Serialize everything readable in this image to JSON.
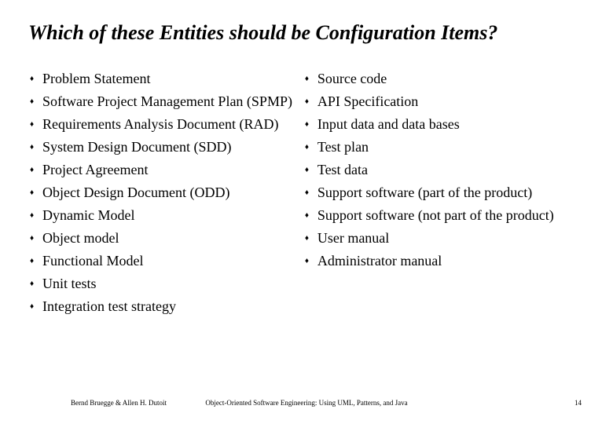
{
  "title": "Which of these Entities should be Configuration Items?",
  "left_items": [
    "Problem Statement",
    "Software Project Management Plan (SPMP)",
    "Requirements Analysis Document (RAD)",
    "System Design Document (SDD)",
    "Project Agreement",
    "Object Design Document  (ODD)",
    "Dynamic Model",
    "Object model",
    "Functional Model",
    "Unit tests",
    "Integration test strategy"
  ],
  "right_items": [
    "Source code",
    "API Specification",
    "Input data and data bases",
    "Test plan",
    "Test data",
    "Support software (part of the product)",
    "Support software (not part of the product)",
    "User manual",
    "Administrator manual"
  ],
  "footer": {
    "left": "Bernd Bruegge & Allen H. Dutoit",
    "center": "Object-Oriented Software Engineering: Using UML, Patterns, and Java",
    "right": "14"
  }
}
